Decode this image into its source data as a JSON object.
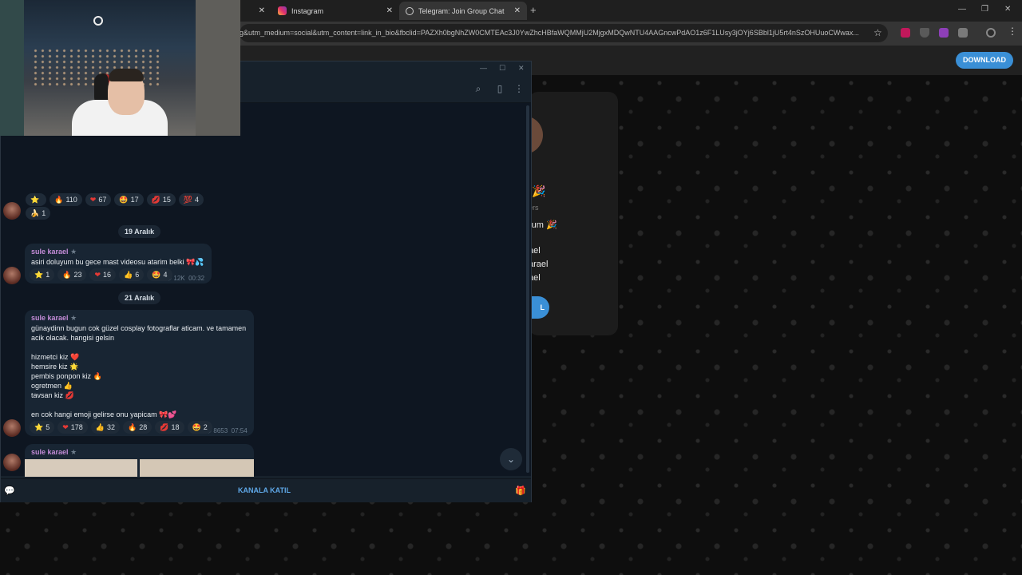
{
  "browser": {
    "tabs": [
      {
        "label": "",
        "close": "✕"
      },
      {
        "label": "Instagram",
        "close": "✕"
      },
      {
        "label": "Telegram: Join Group Chat",
        "close": "✕"
      }
    ],
    "new_tab": "+",
    "url": "g&utm_medium=social&utm_content=link_in_bio&fbclid=PAZXh0bgNhZW0CMTEAc3J0YwZhcHBfaWQMMjU2MjgxMDQwNTU4AAGncwPdAO1z6F1LUsy3jOYj6SBbl1jU5rt4nSzOHUuoCWwax...",
    "colors": {
      "accent": "#3a8fd6"
    }
  },
  "telegram_web": {
    "download_label": "DOWNLOAD",
    "card_lines": [
      "ers",
      "rum 🎉",
      "ael",
      "arael",
      "ael"
    ],
    "join_fragment": "L"
  },
  "tg_desktop": {
    "reactions_1": [
      {
        "e": "⭐",
        "n": ""
      },
      {
        "e": "🔥",
        "n": "110"
      },
      {
        "e": "❤",
        "n": "67"
      },
      {
        "e": "🤩",
        "n": "17"
      },
      {
        "e": "💋",
        "n": "15"
      },
      {
        "e": "💯",
        "n": "4"
      }
    ],
    "reactions_1b": [
      {
        "e": "🍌",
        "n": "1"
      }
    ],
    "date_1": "19 Aralık",
    "msg_1": {
      "author": "sule karael",
      "star": "★",
      "text": "asiri doluyum bu gece mast videosu atarim belki 🎀💦",
      "views": "12K",
      "time": "00:32",
      "reactions": [
        {
          "e": "⭐",
          "n": "1"
        },
        {
          "e": "🔥",
          "n": "23"
        },
        {
          "e": "❤",
          "n": "16"
        },
        {
          "e": "👍",
          "n": "6"
        },
        {
          "e": "🤩",
          "n": "4"
        }
      ]
    },
    "date_2": "21 Aralık",
    "msg_2": {
      "author": "sule karael",
      "star": "★",
      "lines": [
        "günaydinn bugun cok güzel cosplay fotograflar aticam. ve tamamen",
        "acik olacak. hangisi gelsin",
        "",
        "hizmetci kiz ❤️",
        "hemsire kiz 🌟",
        "pembis ponpon kiz 🔥",
        "ogretmen 👍",
        "tavsan kiz 💋",
        "",
        "en cok hangi emoji gelirse onu yapicam 🎀💕"
      ],
      "views": "8653",
      "time": "07:54",
      "reactions": [
        {
          "e": "⭐",
          "n": "5"
        },
        {
          "e": "❤",
          "n": "178"
        },
        {
          "e": "👍",
          "n": "32"
        },
        {
          "e": "🔥",
          "n": "28"
        },
        {
          "e": "💋",
          "n": "18"
        },
        {
          "e": "🤩",
          "n": "2"
        }
      ]
    },
    "msg_3": {
      "author": "sule karael",
      "star": "★"
    },
    "join_channel": "KANALA KATIL",
    "scroll_down": "⌄"
  }
}
